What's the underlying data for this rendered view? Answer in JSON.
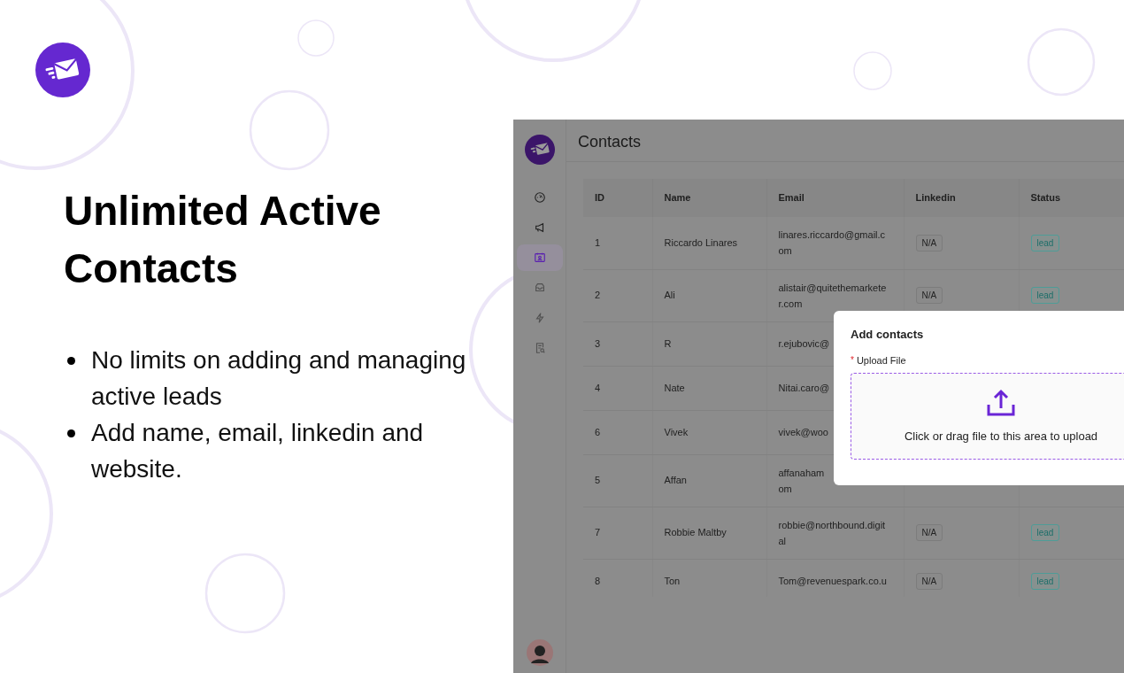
{
  "slide": {
    "heading": "Unlimited Active Contacts",
    "bullets": [
      "No limits on adding and managing active leads",
      "Add name, email, linkedin and website."
    ]
  },
  "app": {
    "page_title": "Contacts",
    "nav": [
      {
        "selected": false,
        "faded": false
      },
      {
        "selected": false,
        "faded": false
      },
      {
        "selected": true,
        "faded": false
      },
      {
        "selected": false,
        "faded": true
      },
      {
        "selected": false,
        "faded": true
      },
      {
        "selected": false,
        "faded": true
      }
    ],
    "table": {
      "columns": [
        "ID",
        "Name",
        "Email",
        "Linkedin",
        "Status"
      ],
      "rows": [
        {
          "id": "1",
          "name": "Riccardo Linares",
          "email": "linares.riccardo@gmail.c\nom",
          "linkedin": "N/A",
          "status": "lead"
        },
        {
          "id": "2",
          "name": "Ali",
          "email": "alistair@quitethemarkete\nr.com",
          "linkedin": "N/A",
          "status": "lead"
        },
        {
          "id": "3",
          "name": "R",
          "email": "r.ejubovic@"
        },
        {
          "id": "4",
          "name": "Nate",
          "email": "Nitai.caro@"
        },
        {
          "id": "6",
          "name": "Vivek",
          "email": "vivek@woo"
        },
        {
          "id": "5",
          "name": "Affan",
          "email": "affanaham\nom"
        },
        {
          "id": "7",
          "name": "Robbie Maltby",
          "email": "robbie@northbound.digit\nal",
          "linkedin": "N/A",
          "status": "lead"
        },
        {
          "id": "8",
          "name": "Ton",
          "email": "Tom@revenuespark.co.u",
          "linkedin": "N/A",
          "status": "lead"
        }
      ]
    },
    "modal": {
      "title": "Add contacts",
      "required": true,
      "required_mark": "*",
      "field_label": "Upload File",
      "dropzone_text": "Click or drag file to this area to upload"
    }
  }
}
